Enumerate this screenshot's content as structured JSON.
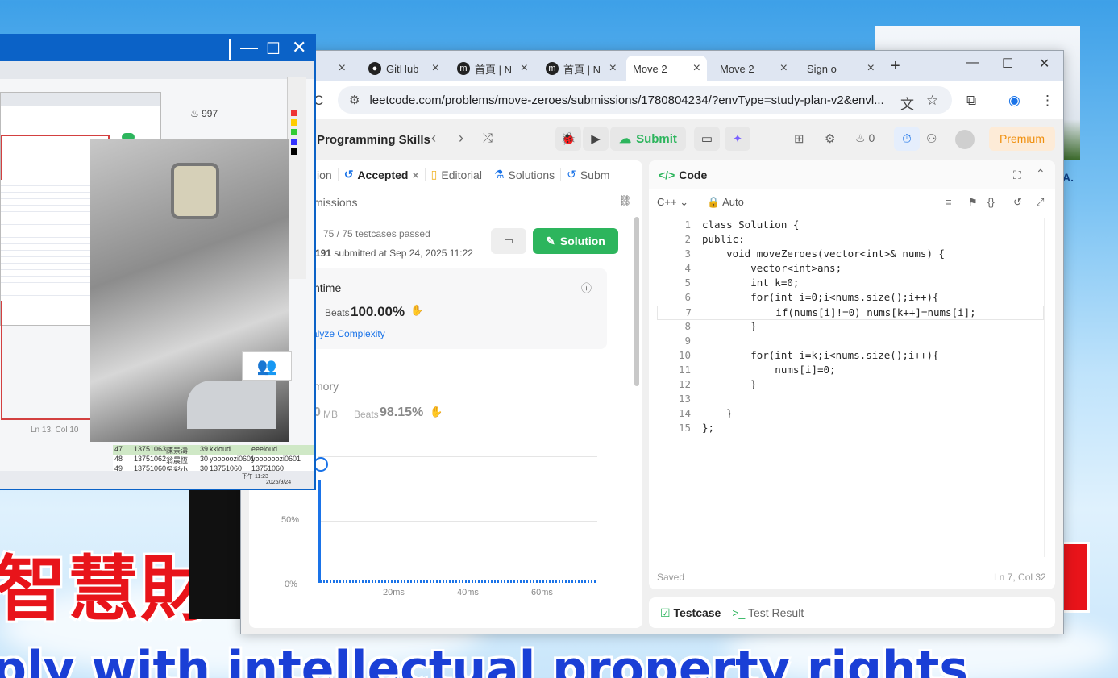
{
  "wallpaper": {
    "big_cjk": "智慧財",
    "bottom_text": "ply with intellectual property rights",
    "corner_letter": "A."
  },
  "browser": {
    "tabs": [
      {
        "label": "",
        "active": false
      },
      {
        "label": "GitHub",
        "active": false
      },
      {
        "label": "首頁 | N",
        "active": false
      },
      {
        "label": "首頁 | N",
        "active": false
      },
      {
        "label": "Move 2",
        "active": true
      },
      {
        "label": "Move 2",
        "active": false
      },
      {
        "label": "Sign o",
        "active": false
      }
    ],
    "new_tab": "+",
    "url": "leetcode.com/problems/move-zeroes/submissions/1780804234/?envType=study-plan-v2&envl..."
  },
  "leetcode": {
    "study_plan": "Programming Skills",
    "submit_label": "Submit",
    "streak": "0",
    "premium_label": "Premium",
    "left_tabs": [
      "ion",
      "Accepted",
      "Editorial",
      "Solutions",
      "Subm"
    ],
    "submissions_label": "missions",
    "testcases": "75 / 75 testcases passed",
    "user": "191",
    "submitted_at": "submitted at Sep 24, 2025 11:22",
    "solution_label": "Solution",
    "runtime_label": "ntime",
    "beats_label": "Beats",
    "runtime_beats": "100.00%",
    "analyze": "alyze Complexity",
    "memory_label": "mory",
    "memory_value": "0",
    "memory_unit": "MB",
    "memory_beats": "98.15%",
    "chart_y": [
      "50%",
      "0%"
    ],
    "chart_x": [
      "20ms",
      "40ms",
      "60ms"
    ],
    "code_tab": "Code",
    "language": "C++",
    "auto_label": "Auto",
    "saved": "Saved",
    "cursor_pos": "Ln 7, Col 32",
    "testcase_tab": "Testcase",
    "test_result_tab": "Test Result",
    "code": [
      "class Solution {",
      "public:",
      "    void moveZeroes(vector<int>& nums) {",
      "        vector<int>ans;",
      "        int k=0;",
      "        for(int i=0;i<nums.size();i++){",
      "            if(nums[i]!=0) nums[k++]=nums[i];",
      "        }",
      "",
      "        for(int i=k;i<nums.size();i++){",
      "            nums[i]=0;",
      "        }",
      "",
      "    }",
      "};"
    ]
  },
  "overlay": {
    "streak": "997",
    "editor_status": "Ln 13, Col 10",
    "taskbar_time": "下午 11:23",
    "taskbar_date": "2025/9/24",
    "table_rows": [
      [
        "47",
        "13751063",
        "陳景濤",
        "39",
        "kkloud",
        "eeeloud"
      ],
      [
        "48",
        "13751062",
        "翁晨恆",
        "30",
        "yooooozi0601",
        "yoooooozi0601"
      ],
      [
        "49",
        "13751060",
        "吳彩小",
        "30",
        "13751060",
        "13751060"
      ]
    ]
  }
}
